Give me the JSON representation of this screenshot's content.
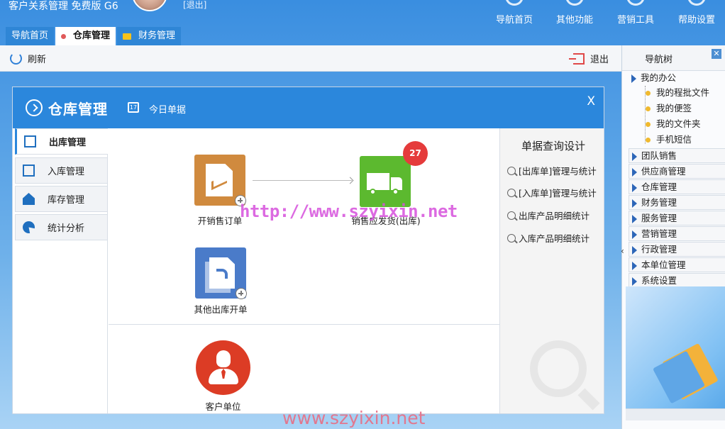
{
  "header": {
    "app_title": "客户关系管理 免费版 G6",
    "logout_link": "[退出]",
    "nav": [
      "导航首页",
      "其他功能",
      "营销工具",
      "帮助设置"
    ]
  },
  "tabs": [
    {
      "label": "导航首页",
      "active": false
    },
    {
      "label": "仓库管理",
      "active": true
    },
    {
      "label": "财务管理",
      "active": false
    }
  ],
  "toolbar": {
    "refresh": "刷新",
    "exit": "退出"
  },
  "panel": {
    "title": "仓库管理",
    "today": "今日单据",
    "close": "X",
    "calendar_day": "17",
    "side_tabs": [
      "出库管理",
      "入库管理",
      "库存管理",
      "统计分析"
    ],
    "flow": {
      "create_order": "开销售订单",
      "ship": "销售应发货(出库)",
      "ship_badge": "27",
      "other_out": "其他出库开单",
      "customer": "客户单位"
    },
    "query": {
      "title": "单据查询设计",
      "items": [
        "[出库单]管理与统计",
        "[入库单]管理与统计",
        "出库产品明细统计",
        "入库产品明细统计"
      ]
    }
  },
  "navtree": {
    "title": "导航树",
    "close": "✕",
    "groups": [
      {
        "label": "我的办公",
        "children": [
          "我的程批文件",
          "我的便签",
          "我的文件夹",
          "手机短信"
        ]
      },
      {
        "label": "团队销售"
      },
      {
        "label": "供应商管理"
      },
      {
        "label": "仓库管理"
      },
      {
        "label": "财务管理"
      },
      {
        "label": "服务管理"
      },
      {
        "label": "营销管理"
      },
      {
        "label": "行政管理"
      },
      {
        "label": "本单位管理"
      },
      {
        "label": "系统设置"
      }
    ]
  },
  "watermarks": {
    "center": "http://www.szyixin.net",
    "bottom": "www.szyixin.net"
  },
  "colors": {
    "accent": "#2b87dc",
    "badge": "#e53b3b",
    "order_icon": "#d08a3e",
    "ship_icon": "#5cb92f",
    "other_icon": "#4a7bc9",
    "customer_icon": "#dc3c25"
  }
}
